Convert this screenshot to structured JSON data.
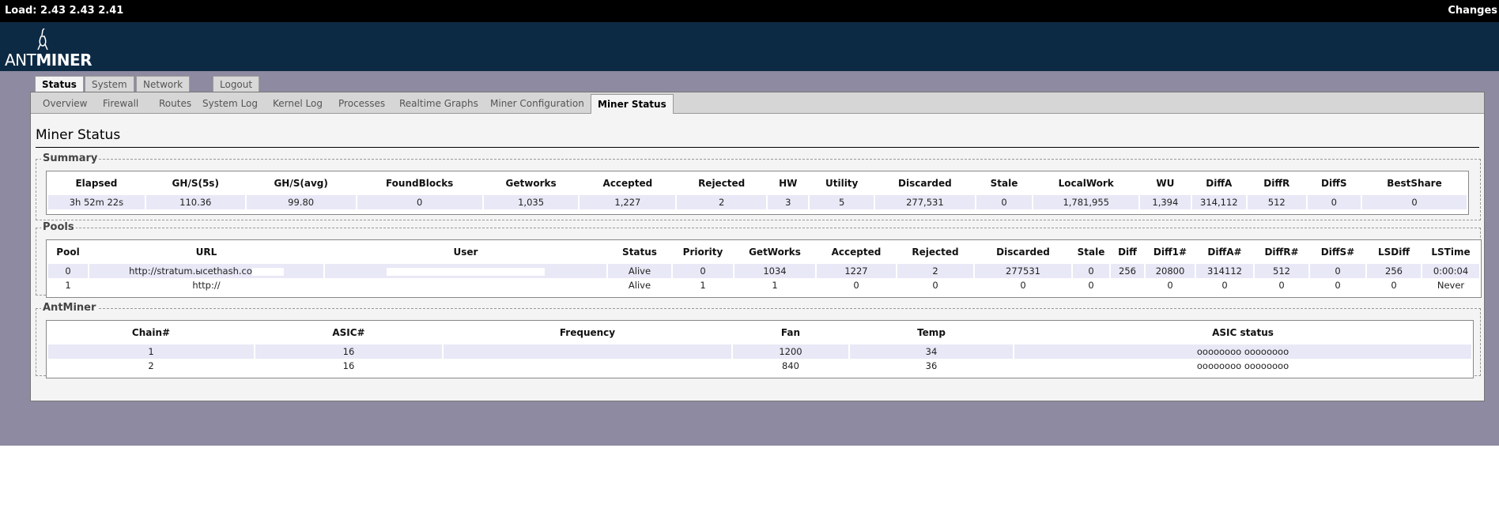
{
  "topbar": {
    "load": "Load: 2.43 2.43 2.41",
    "changes": "Changes"
  },
  "logo": {
    "ant": "ANT",
    "miner": "MINER"
  },
  "main_tabs": [
    "Status",
    "System",
    "Network",
    "Logout"
  ],
  "sub_tabs": [
    "Overview",
    "Firewall",
    "Routes",
    "System Log",
    "Kernel Log",
    "Processes",
    "Realtime Graphs",
    "Miner Configuration",
    "Miner Status"
  ],
  "page_title": "Miner Status",
  "summary": {
    "legend": "Summary",
    "headers": [
      "Elapsed",
      "GH/S(5s)",
      "GH/S(avg)",
      "FoundBlocks",
      "Getworks",
      "Accepted",
      "Rejected",
      "HW",
      "Utility",
      "Discarded",
      "Stale",
      "LocalWork",
      "WU",
      "DiffA",
      "DiffR",
      "DiffS",
      "BestShare"
    ],
    "row": [
      "3h 52m 22s",
      "110.36",
      "99.80",
      "0",
      "1,035",
      "1,227",
      "2",
      "3",
      "5",
      "277,531",
      "0",
      "1,781,955",
      "1,394",
      "314,112",
      "512",
      "0",
      "0"
    ]
  },
  "pools": {
    "legend": "Pools",
    "headers": [
      "Pool",
      "URL",
      "User",
      "Status",
      "Priority",
      "GetWorks",
      "Accepted",
      "Rejected",
      "Discarded",
      "Stale",
      "Diff",
      "Diff1#",
      "DiffA#",
      "DiffR#",
      "DiffS#",
      "LSDiff",
      "LSTime"
    ],
    "rows": [
      [
        "0",
        "http://stratum.ыcethash.co",
        "",
        "Alive",
        "0",
        "1034",
        "1227",
        "2",
        "277531",
        "0",
        "256",
        "20800",
        "314112",
        "512",
        "0",
        "256",
        "0:00:04"
      ],
      [
        "1",
        "http://",
        "",
        "Alive",
        "1",
        "1",
        "0",
        "0",
        "0",
        "0",
        "",
        "0",
        "0",
        "0",
        "0",
        "0",
        "Never"
      ]
    ]
  },
  "antminer": {
    "legend": "AntMiner",
    "headers": [
      "Chain#",
      "ASIC#",
      "Frequency",
      "Fan",
      "Temp",
      "ASIC status"
    ],
    "rows": [
      [
        "1",
        "16",
        "",
        "1200",
        "34",
        "oooooooo oooooooo"
      ],
      [
        "2",
        "16",
        "",
        "840",
        "36",
        "oooooooo oooooooo"
      ]
    ]
  }
}
